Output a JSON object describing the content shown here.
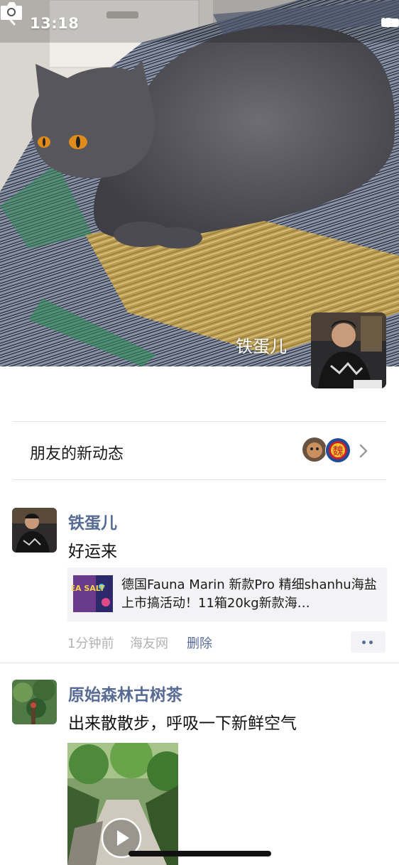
{
  "status_bar": {
    "time": "13:18"
  },
  "cover": {
    "profile_name": "铁蛋儿",
    "camera_icon": "camera-icon",
    "back_icon": "chevron-left-icon"
  },
  "friend_updates": {
    "label": "朋友的新动态",
    "chevron_icon": "chevron-right-icon",
    "badge_char": "魏"
  },
  "posts": [
    {
      "author": "铁蛋儿",
      "text": "好运来",
      "link": {
        "title": "德国Fauna Marin 新款Pro 精细shanhu海盐上市搞活动！11箱20kg新款海…",
        "thumb_text": "SEA SALT"
      },
      "time": "1分钟前",
      "source": "海友网",
      "delete_label": "删除"
    },
    {
      "author": "原始森林古树茶",
      "text": "出来散散步，呼吸一下新鲜空气",
      "media_type": "video",
      "play_icon": "play-icon"
    }
  ],
  "colors": {
    "link_blue": "#576b95",
    "meta_gray": "#b2b2b2",
    "card_bg": "#f3f3f5"
  }
}
